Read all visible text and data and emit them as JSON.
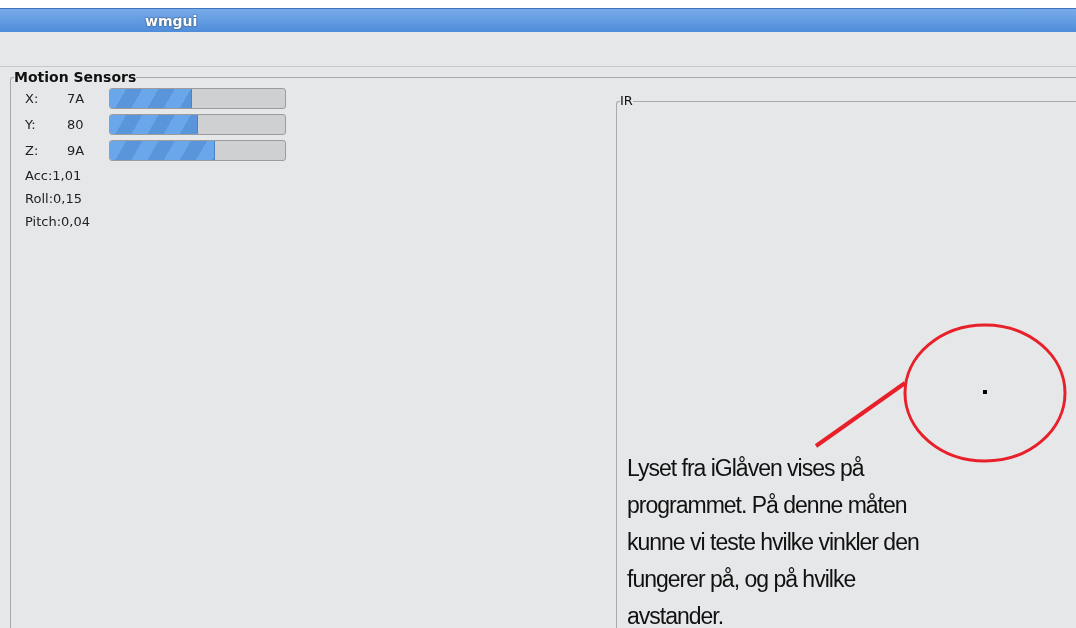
{
  "window": {
    "title": "wmgui"
  },
  "motion_sensors": {
    "title": "Motion Sensors",
    "axes": [
      {
        "label": "X:",
        "value": "7A",
        "level": 0.47
      },
      {
        "label": "Y:",
        "value": "80",
        "level": 0.5
      },
      {
        "label": "Z:",
        "value": "9A",
        "level": 0.6
      }
    ],
    "readings": [
      {
        "label": "Acc:",
        "value": "1,01"
      },
      {
        "label": "Roll:",
        "value": "0,15"
      },
      {
        "label": "Pitch:",
        "value": "0,04"
      }
    ]
  },
  "ir": {
    "title": "IR"
  },
  "annotation": {
    "text": "Lyset fra iGlåven vises på programmet. På denne måten kunne vi teste hvilke vinkler den fungerer på, og på hvilke avstander."
  }
}
